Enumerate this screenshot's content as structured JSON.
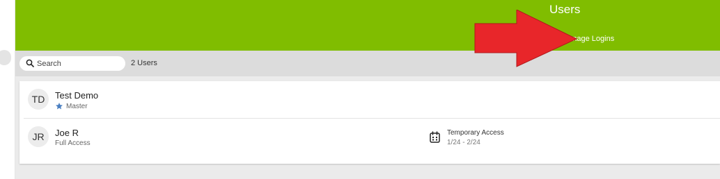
{
  "header": {
    "title": "Users",
    "manage_logins_label": "Manage Logins",
    "background_color": "#80bd00"
  },
  "annotation": {
    "type": "arrow",
    "color": "#e8262a",
    "points_to": "Manage Logins"
  },
  "toolbar": {
    "search_placeholder": "Search",
    "search_value": "",
    "user_count": "2 Users"
  },
  "users": [
    {
      "initials": "TD",
      "name": "Test Demo",
      "role": "Master",
      "role_icon": "star-icon",
      "role_icon_color": "#4a7fc1"
    },
    {
      "initials": "JR",
      "name": "Joe R",
      "role": "Full Access",
      "access_icon": "calendar-icon",
      "access_type": "Temporary Access",
      "access_dates": "1/24 - 2/24"
    }
  ]
}
